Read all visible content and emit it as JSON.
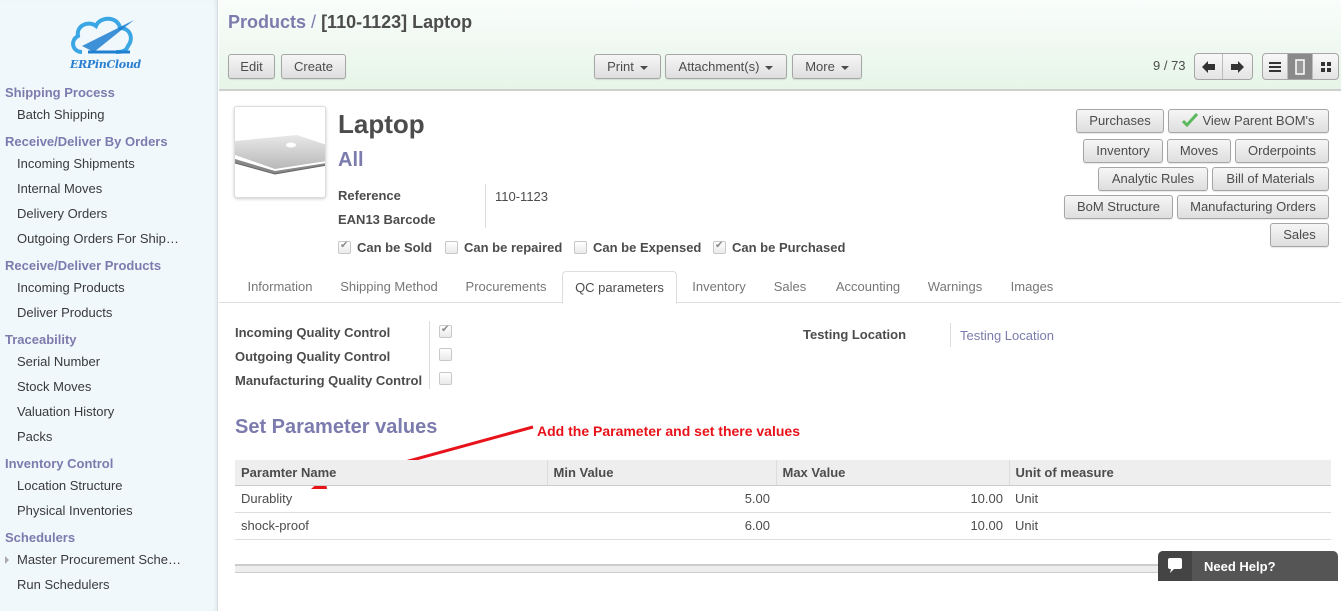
{
  "brand": {
    "name": "ERPinCloud"
  },
  "sidebar": {
    "sections": [
      {
        "title": "Shipping Process",
        "items": [
          {
            "label": "Batch Shipping"
          }
        ]
      },
      {
        "title": "Receive/Deliver By Orders",
        "items": [
          {
            "label": "Incoming Shipments"
          },
          {
            "label": "Internal Moves"
          },
          {
            "label": "Delivery Orders"
          },
          {
            "label": "Outgoing Orders For Ship…"
          }
        ]
      },
      {
        "title": "Receive/Deliver Products",
        "items": [
          {
            "label": "Incoming Products"
          },
          {
            "label": "Deliver Products"
          }
        ]
      },
      {
        "title": "Traceability",
        "items": [
          {
            "label": "Serial Number"
          },
          {
            "label": "Stock Moves"
          },
          {
            "label": "Valuation History"
          },
          {
            "label": "Packs"
          }
        ]
      },
      {
        "title": "Inventory Control",
        "items": [
          {
            "label": "Location Structure"
          },
          {
            "label": "Physical Inventories"
          }
        ]
      },
      {
        "title": "Schedulers",
        "items": [
          {
            "label": "Master Procurement Sche…",
            "expandable": true
          },
          {
            "label": "Run Schedulers"
          }
        ]
      }
    ]
  },
  "header": {
    "breadcrumb_parent": "Products",
    "breadcrumb_sep": "/",
    "breadcrumb_current": "[110-1123] Laptop",
    "edit_label": "Edit",
    "create_label": "Create",
    "print_label": "Print",
    "attachments_label": "Attachment(s)",
    "more_label": "More",
    "pager": "9 / 73",
    "active_view": "form"
  },
  "product": {
    "name": "Laptop",
    "category": "All",
    "reference_label": "Reference",
    "reference_value": "110-1123",
    "barcode_label": "EAN13 Barcode",
    "barcode_value": "",
    "flags": [
      {
        "label": "Can be Sold",
        "checked": true
      },
      {
        "label": "Can be repaired",
        "checked": false
      },
      {
        "label": "Can be Expensed",
        "checked": false
      },
      {
        "label": "Can be Purchased",
        "checked": true
      }
    ]
  },
  "smart_buttons": {
    "purchases": "Purchases",
    "view_parent_boms": "View Parent BOM's",
    "inventory": "Inventory",
    "moves": "Moves",
    "orderpoints": "Orderpoints",
    "analytic_rules": "Analytic Rules",
    "bill_of_materials": "Bill of Materials",
    "bom_structure": "BoM Structure",
    "manufacturing_orders": "Manufacturing Orders",
    "sales": "Sales"
  },
  "tabs": [
    {
      "label": "Information"
    },
    {
      "label": "Shipping Method"
    },
    {
      "label": "Procurements"
    },
    {
      "label": "QC parameters",
      "active": true
    },
    {
      "label": "Inventory"
    },
    {
      "label": "Sales"
    },
    {
      "label": "Accounting"
    },
    {
      "label": "Warnings"
    },
    {
      "label": "Images"
    }
  ],
  "qc": {
    "incoming_label": "Incoming Quality Control",
    "incoming_checked": true,
    "outgoing_label": "Outgoing Quality Control",
    "outgoing_checked": false,
    "manufacturing_label": "Manufacturing Quality Control",
    "manufacturing_checked": false,
    "testing_location_label": "Testing Location",
    "testing_location_value": "Testing Location",
    "section_title": "Set Parameter values",
    "annotation": "Add the Parameter and set there values",
    "columns": [
      "Paramter Name",
      "Min Value",
      "Max Value",
      "Unit of measure"
    ],
    "rows": [
      {
        "name": "Durablity",
        "min": "5.00",
        "max": "10.00",
        "uom": "Unit"
      },
      {
        "name": "shock-proof",
        "min": "6.00",
        "max": "10.00",
        "uom": "Unit"
      }
    ]
  },
  "help_widget": {
    "label": "Need Help?"
  },
  "colors": {
    "accent": "#7c7bad",
    "annotation": "#e8131a",
    "header_bg": "#e6f5e8"
  }
}
